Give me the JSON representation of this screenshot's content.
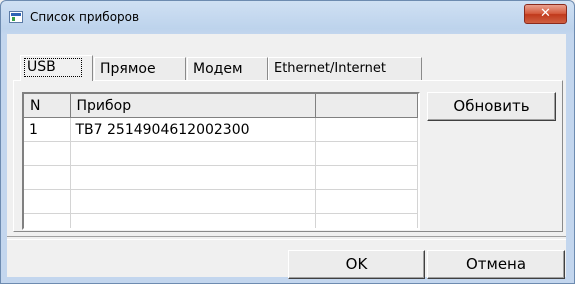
{
  "window": {
    "title": "Список приборов",
    "close_glyph": "✕"
  },
  "tabs": [
    {
      "label": "USB",
      "active": true
    },
    {
      "label": "Прямое",
      "active": false
    },
    {
      "label": "Модем",
      "active": false
    },
    {
      "label": "Ethernet/Internet",
      "active": false
    }
  ],
  "table": {
    "columns": [
      "N",
      "Прибор",
      ""
    ],
    "rows": [
      [
        "1",
        "ТВ7 2514904612002300",
        ""
      ],
      [
        "",
        "",
        ""
      ],
      [
        "",
        "",
        ""
      ],
      [
        "",
        "",
        ""
      ],
      [
        "",
        "",
        ""
      ]
    ]
  },
  "buttons": {
    "refresh": "Обновить",
    "ok": "OK",
    "cancel": "Отмена"
  },
  "icons": {
    "app": "window-icon",
    "close": "close-icon"
  }
}
